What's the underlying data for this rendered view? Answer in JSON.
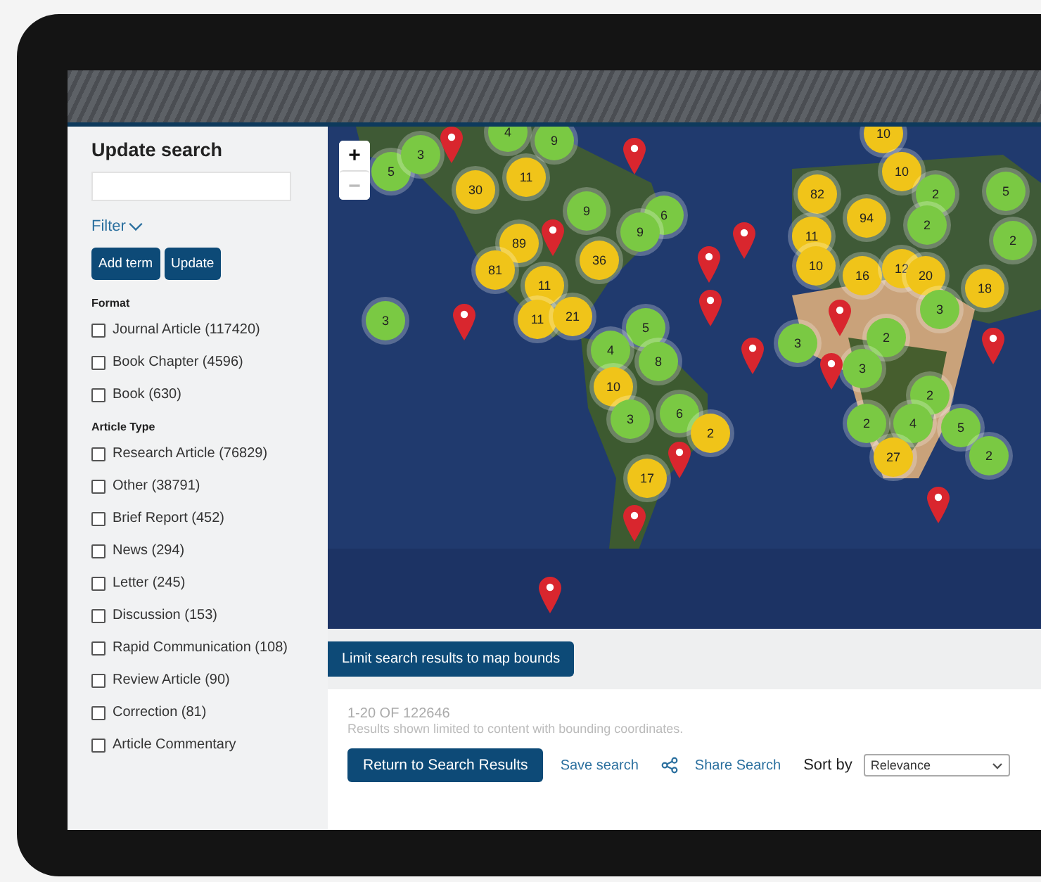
{
  "sidebar": {
    "title": "Update search",
    "filter_label": "Filter",
    "buttons": [
      "Add term",
      "Update"
    ],
    "groups": [
      {
        "heading": "Format",
        "items": [
          {
            "label": "Journal Article (117420)",
            "checked": false
          },
          {
            "label": "Book Chapter (4596)",
            "checked": false
          },
          {
            "label": "Book (630)",
            "checked": false
          }
        ]
      },
      {
        "heading": "Article Type",
        "items": [
          {
            "label": "Research Article (76829)",
            "checked": false
          },
          {
            "label": "Other (38791)",
            "checked": false
          },
          {
            "label": "Brief Report (452)",
            "checked": false
          },
          {
            "label": "News (294)",
            "checked": false
          },
          {
            "label": "Letter (245)",
            "checked": false
          },
          {
            "label": "Discussion (153)",
            "checked": false
          },
          {
            "label": "Rapid Communication (108)",
            "checked": false
          },
          {
            "label": "Review Article (90)",
            "checked": false
          },
          {
            "label": "Correction (81)",
            "checked": false
          },
          {
            "label": "Article Commentary",
            "checked": false
          }
        ]
      }
    ]
  },
  "map": {
    "zoom_in": "+",
    "zoom_out": "−",
    "clusters": [
      {
        "count": "5",
        "color": "#7ac943"
      },
      {
        "count": "3",
        "color": "#7ac943"
      },
      {
        "count": "4",
        "color": "#7ac943"
      },
      {
        "count": "9",
        "color": "#7ac943"
      },
      {
        "count": "30",
        "color": "#f0c419"
      },
      {
        "count": "11",
        "color": "#f0c419"
      },
      {
        "count": "9",
        "color": "#7ac943"
      },
      {
        "count": "6",
        "color": "#7ac943"
      },
      {
        "count": "9",
        "color": "#7ac943"
      },
      {
        "count": "89",
        "color": "#f0c419"
      },
      {
        "count": "36",
        "color": "#f0c419"
      },
      {
        "count": "81",
        "color": "#f0c419"
      },
      {
        "count": "11",
        "color": "#f0c419"
      },
      {
        "count": "3",
        "color": "#7ac943"
      },
      {
        "count": "11",
        "color": "#f0c419"
      },
      {
        "count": "21",
        "color": "#f0c419"
      },
      {
        "count": "5",
        "color": "#7ac943"
      },
      {
        "count": "4",
        "color": "#7ac943"
      },
      {
        "count": "8",
        "color": "#7ac943"
      },
      {
        "count": "10",
        "color": "#f0c419"
      },
      {
        "count": "3",
        "color": "#7ac943"
      },
      {
        "count": "6",
        "color": "#7ac943"
      },
      {
        "count": "2",
        "color": "#f0c419"
      },
      {
        "count": "17",
        "color": "#f0c419"
      },
      {
        "count": "10",
        "color": "#f0c419"
      },
      {
        "count": "10",
        "color": "#f0c419"
      },
      {
        "count": "82",
        "color": "#f0c419"
      },
      {
        "count": "94",
        "color": "#f0c419"
      },
      {
        "count": "11",
        "color": "#f0c419"
      },
      {
        "count": "10",
        "color": "#f0c419"
      },
      {
        "count": "16",
        "color": "#f0c419"
      },
      {
        "count": "12",
        "color": "#f0c419"
      },
      {
        "count": "20",
        "color": "#f0c419"
      },
      {
        "count": "2",
        "color": "#7ac943"
      },
      {
        "count": "2",
        "color": "#7ac943"
      },
      {
        "count": "5",
        "color": "#7ac943"
      },
      {
        "count": "2",
        "color": "#7ac943"
      },
      {
        "count": "18",
        "color": "#f0c419"
      },
      {
        "count": "3",
        "color": "#7ac943"
      },
      {
        "count": "3",
        "color": "#7ac943"
      },
      {
        "count": "2",
        "color": "#7ac943"
      },
      {
        "count": "3",
        "color": "#7ac943"
      },
      {
        "count": "2",
        "color": "#7ac943"
      },
      {
        "count": "2",
        "color": "#7ac943"
      },
      {
        "count": "4",
        "color": "#7ac943"
      },
      {
        "count": "5",
        "color": "#7ac943"
      },
      {
        "count": "2",
        "color": "#7ac943"
      },
      {
        "count": "27",
        "color": "#f0c419"
      }
    ]
  },
  "limit_button": "Limit search results to map bounds",
  "results": {
    "count": "1-20 OF 122646",
    "note": "Results shown limited to content with bounding coordinates.",
    "return_button": "Return to Search Results",
    "save_link": "Save search",
    "share_link": "Share Search",
    "sort_label": "Sort by",
    "sort_value": "Relevance"
  }
}
